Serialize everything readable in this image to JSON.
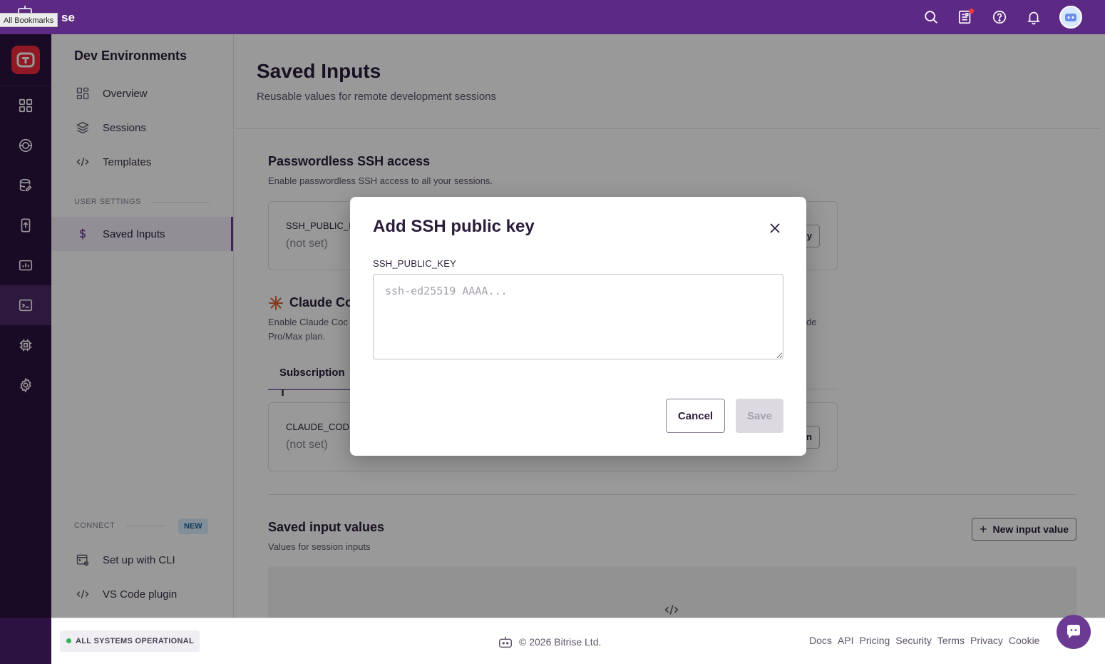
{
  "browser": {
    "bookmarks_label": "All Bookmarks"
  },
  "topbar": {
    "logo_text": "se"
  },
  "sidenav": {
    "title": "Dev Environments",
    "items": [
      {
        "label": "Overview",
        "icon": "grid-icon"
      },
      {
        "label": "Sessions",
        "icon": "layers-icon"
      },
      {
        "label": "Templates",
        "icon": "code-icon"
      }
    ],
    "user_settings_label": "USER SETTINGS",
    "user_items": [
      {
        "label": "Saved Inputs",
        "icon": "dollar-icon"
      }
    ],
    "connect_label": "CONNECT",
    "new_badge": "NEW",
    "connect_items": [
      {
        "label": "Set up with CLI",
        "icon": "cli-icon"
      },
      {
        "label": "VS Code plugin",
        "icon": "code-icon"
      }
    ]
  },
  "main": {
    "title": "Saved Inputs",
    "subtitle": "Reusable values for remote development sessions",
    "ssh": {
      "title": "Passwordless SSH access",
      "desc": "Enable passwordless SSH access to all your sessions.",
      "card_label": "SSH_PUBLIC_I",
      "card_value": "(not set)",
      "card_button": "y"
    },
    "claude": {
      "title": "Claude Co",
      "desc_left_1": "Enable Claude Coc",
      "desc_left_2": "Pro/Max plan.",
      "desc_right": "de",
      "tab_label": "Subscription T",
      "card_label": "CLAUDE_COD",
      "card_value": "(not set)",
      "card_button": "n"
    },
    "saved_values": {
      "title": "Saved input values",
      "desc": "Values for session inputs",
      "new_button": "New input value"
    }
  },
  "modal": {
    "title": "Add SSH public key",
    "field_label": "SSH_PUBLIC_KEY",
    "field_value": "",
    "field_placeholder": "ssh-ed25519 AAAA...",
    "cancel_label": "Cancel",
    "save_label": "Save"
  },
  "footer": {
    "status": "ALL SYSTEMS OPERATIONAL",
    "copyright": "© 2026 Bitrise Ltd.",
    "links": [
      "Docs",
      "API",
      "Pricing",
      "Security",
      "Terms",
      "Privacy",
      "Cookie"
    ]
  },
  "colors": {
    "brand": "#5c2a85",
    "rail": "#2b1240",
    "accent": "#6b3a93",
    "status_ok": "#2fb45a",
    "logo_red": "#f0283a"
  }
}
